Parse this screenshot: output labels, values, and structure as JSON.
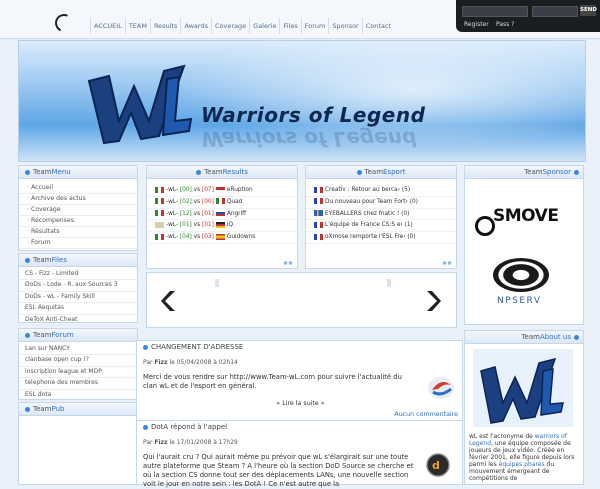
{
  "nav": [
    "ACCUEIL",
    "TEAM",
    "Results",
    "Awards",
    "Coverage",
    "Galerie",
    "Files",
    "Forum",
    "Sponsor",
    "Contact"
  ],
  "login": {
    "send": "SEND",
    "register": "Register",
    "pass": "Pass ?"
  },
  "banner": {
    "title": "Warriors of Legend"
  },
  "menu": {
    "head_a": "Team",
    "head_b": "Menu",
    "items": [
      "Accueil",
      "Archive des actus",
      "Coverage",
      "Récompenses",
      "Résultats",
      "Forum"
    ]
  },
  "files": {
    "head_a": "Team",
    "head_b": "Files",
    "items": [
      "CS - Fizz - Limited",
      "DoDs - Lode - R. aux Sources 3",
      "DoDs - wL - Family Skill",
      "ESL Aequitas",
      "DeToX Anti-Cheat"
    ]
  },
  "forum": {
    "head_a": "Team",
    "head_b": "Forum",
    "items": [
      "Lan sur NANCY",
      "clanbase open cup !?",
      "inscription league et MDP",
      "telephone des membres",
      "ESL dota"
    ]
  },
  "pub": {
    "head_a": "Team",
    "head_b": "Pub"
  },
  "results": {
    "head_a": "Team",
    "head_b": "Results",
    "rows": [
      {
        "team": "-wL-",
        "s1": "[00]",
        "vs": "vs",
        "s2": "[07]",
        "opp": "eRuption",
        "c1": "#2a8a2a",
        "c2": "#c53030"
      },
      {
        "team": "-wL-",
        "s1": "[02]",
        "vs": "vs",
        "s2": "[00]",
        "opp": "Quad",
        "c1": "#2a8a2a",
        "c2": "#c53030"
      },
      {
        "team": "-wL-",
        "s1": "[12]",
        "vs": "vs",
        "s2": "[01]",
        "opp": "Angriff",
        "c1": "#2a8a2a",
        "c2": "#c53030"
      },
      {
        "team": "-wL-",
        "s1": "[01]",
        "vs": "vs",
        "s2": "[01]",
        "opp": "iQ",
        "c1": "#2a8a2a",
        "c2": "#c53030"
      },
      {
        "team": "-wL-",
        "s1": "[04]",
        "vs": "vs",
        "s2": "[03]",
        "opp": "Guidowns",
        "c1": "#2a8a2a",
        "c2": "#c53030"
      }
    ]
  },
  "esport": {
    "head_a": "Team",
    "head_b": "Esport",
    "rows": [
      "Creativ : Retour au berca› (5)",
      "Du nouveau pour Team Fort› (0)",
      "EYEBALLERS chez fnatic ! (0)",
      "L'équipe de France CS:S e› (1)",
      "oXmose remporte l'ESL Fre› (0)"
    ]
  },
  "sponsor": {
    "head_a": "Team",
    "head_b": "Sponsor",
    "smove": "SMOVE",
    "npserv": "NPSERV"
  },
  "aboutus": {
    "head_a": "Team",
    "head_b": "About us",
    "text_pre": "wL est l'acronyme de ",
    "text_link1": "warriors of Legend",
    "text_mid": ", une équipe composée de joueurs de jeux vidéo. Créée en février 2001, elle figure depuis lors parmi les ",
    "text_link2": "équipes phares",
    "text_post": " du mouvement émergeant de compétitions de"
  },
  "news1": {
    "title": "CHANGEMENT D'ADRESSE",
    "meta_by": "Par ",
    "author": "Fizz",
    "date": " le 05/04/2008 à 02h14",
    "body": "Merci de vous rendre sur http://www.Team-wL.com pour suivre l'actualité du clan wL et de l'esport en général.",
    "more": "» Lire la suite «",
    "comments": "Aucun commentaire"
  },
  "news2": {
    "title": "DotA répond à l'appel",
    "meta_by": "Par ",
    "author": "Fizz",
    "date": " le 17/01/2008 à 17h29",
    "body": "Qui l'aurait cru ? Qui aurait même pu prévoir que wL s'élargirait sur une toute autre plateforme que Steam ? A l'heure où la section DoD Source se cherche et où la section CS donne tout ser des déplacements LANs, une nouvelle section voit le jour en notre sein : les DotA ! Ce n'est autre que la"
  }
}
